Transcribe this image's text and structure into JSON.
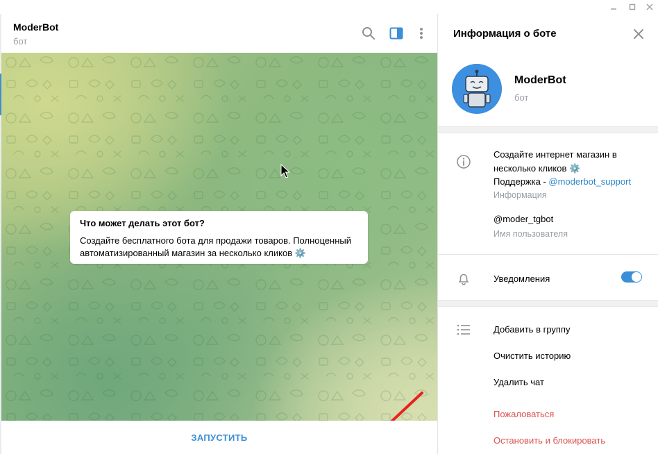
{
  "colors": {
    "accent": "#3a8fd6",
    "link": "#2f86c9",
    "danger": "#d9534f",
    "muted": "#9aa0a6",
    "avatar_bg": "#3d8fe0"
  },
  "window": {
    "controls": [
      "minimize-icon",
      "maximize-icon",
      "close-icon"
    ]
  },
  "chat": {
    "title": "ModerBot",
    "subtitle": "бот",
    "header_icons": [
      "search-icon",
      "sidebar-toggle-icon",
      "more-vert-icon"
    ],
    "card": {
      "title": "Что может делать этот бот?",
      "text": "Создайте бесплатного бота для продажи товаров. Полноценный автоматизированный магазин за несколько кликов ⚙️"
    },
    "start_button": "ЗАПУСТИТЬ"
  },
  "panel": {
    "title": "Информация о боте",
    "profile": {
      "name": "ModerBot",
      "subtitle": "бот"
    },
    "about": {
      "line1": "Создайте интернет магазин в несколько кликов ⚙️",
      "support_prefix": "Поддержка - ",
      "support_link": "@moderbot_support",
      "label": "Информация"
    },
    "username": {
      "value": "@moder_tgbot",
      "label": "Имя пользователя"
    },
    "notifications": {
      "label": "Уведомления",
      "enabled": true
    },
    "actions": {
      "add_to_group": "Добавить в группу",
      "clear_history": "Очистить историю",
      "delete_chat": "Удалить чат",
      "report": "Пожаловаться",
      "stop_and_block": "Остановить и блокировать"
    }
  }
}
